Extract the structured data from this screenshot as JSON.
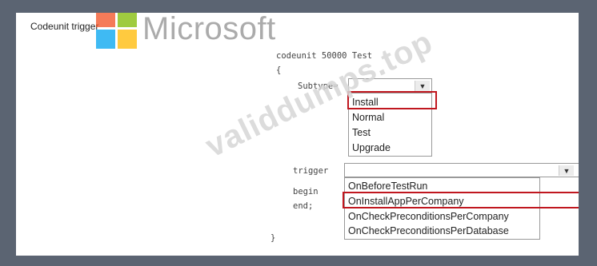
{
  "panel": {
    "title": "Codeunit trigger"
  },
  "watermarks": {
    "microsoft_text": "Microsoft",
    "site_text": "validdumps.top"
  },
  "code": {
    "line1": "codeunit 50000 Test",
    "line2": "{",
    "subtype_label": "Subtype=",
    "trigger_label": "trigger",
    "begin_label": "begin",
    "end_label": "end;",
    "close_brace": "}",
    "trigger_suffix": "()"
  },
  "subtype_dropdown": {
    "selected": "",
    "options": [
      "Install",
      "Normal",
      "Test",
      "Upgrade"
    ],
    "highlighted": "Install"
  },
  "trigger_dropdown": {
    "selected": "",
    "options": [
      "OnBeforeTestRun",
      "OnInstallAppPerCompany",
      "OnCheckPreconditionsPerCompany",
      "OnCheckPreconditionsPerDatabase"
    ],
    "highlighted": "OnInstallAppPerCompany"
  },
  "colors": {
    "highlight_border": "#c0171f",
    "background": "#5b6472"
  }
}
